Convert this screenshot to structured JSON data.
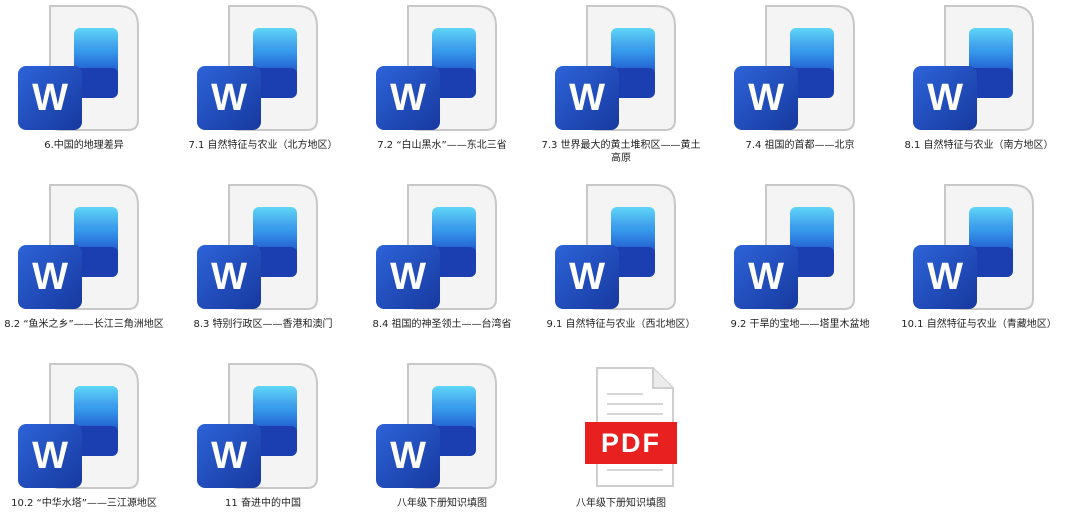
{
  "files": [
    {
      "name": "6.中国的地理差异",
      "type": "word"
    },
    {
      "name": "7.1 自然特征与农业（北方地区）",
      "type": "word"
    },
    {
      "name": "7.2 “白山黑水”——东北三省",
      "type": "word"
    },
    {
      "name": "7.3 世界最大的黄土堆积区——黄土高原",
      "type": "word"
    },
    {
      "name": "7.4 祖国的首都——北京",
      "type": "word"
    },
    {
      "name": "8.1 自然特征与农业（南方地区）",
      "type": "word"
    },
    {
      "name": "8.2 “鱼米之乡”——长江三角洲地区",
      "type": "word"
    },
    {
      "name": "8.3 特别行政区——香港和澳门",
      "type": "word"
    },
    {
      "name": "8.4 祖国的神圣领土——台湾省",
      "type": "word"
    },
    {
      "name": "9.1 自然特征与农业（西北地区）",
      "type": "word"
    },
    {
      "name": "9.2 干旱的宝地——塔里木盆地",
      "type": "word"
    },
    {
      "name": "10.1 自然特征与农业（青藏地区）",
      "type": "word"
    },
    {
      "name": "10.2 “中华水塔”——三江源地区",
      "type": "word"
    },
    {
      "name": "11 奋进中的中国",
      "type": "word"
    },
    {
      "name": "八年级下册知识填图",
      "type": "word"
    },
    {
      "name": "八年级下册知识填图",
      "type": "pdf"
    }
  ],
  "icons": {
    "word_letter": "W",
    "pdf_label": "PDF",
    "word_icon": "word-document-icon",
    "pdf_icon": "pdf-document-icon"
  },
  "colors": {
    "word_badge": "#1f4fc1",
    "word_accent": "#4fc3f7",
    "pdf_red": "#e8201f"
  }
}
